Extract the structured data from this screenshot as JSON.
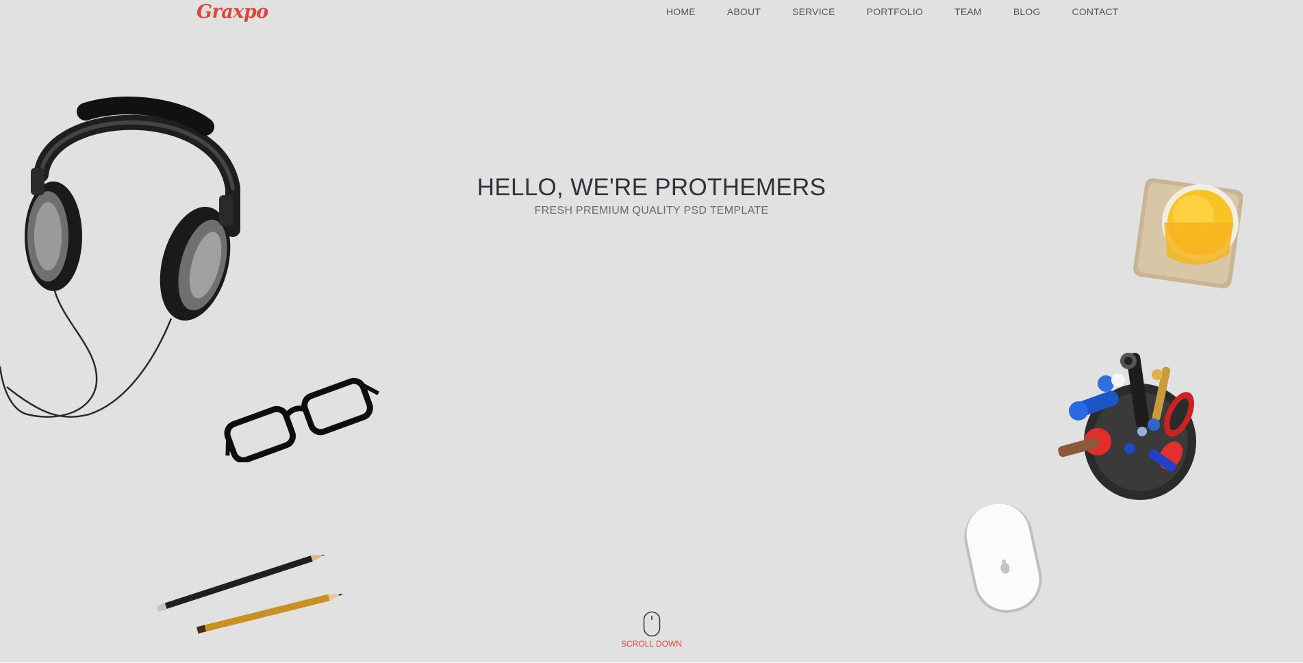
{
  "brand": {
    "logo_text": "Graxpo",
    "accent_color": "#e0453c"
  },
  "nav": {
    "items": [
      {
        "label": "HOME"
      },
      {
        "label": "ABOUT"
      },
      {
        "label": "SERVICE"
      },
      {
        "label": "PORTFOLIO"
      },
      {
        "label": "TEAM"
      },
      {
        "label": "BLOG"
      },
      {
        "label": "CONTACT"
      }
    ]
  },
  "hero": {
    "title": "HELLO, WE'RE PROTHEMERS",
    "subtitle": "FRESH PREMIUM QUALITY PSD TEMPLATE",
    "background_color": "#e1e1e1"
  },
  "scroll": {
    "label": "SCROLL DOWN",
    "icon": "mouse-icon"
  },
  "decorations": [
    {
      "name": "headphones-image"
    },
    {
      "name": "eyeglasses-image"
    },
    {
      "name": "pencils-image"
    },
    {
      "name": "orange-juice-image"
    },
    {
      "name": "pen-holder-image"
    },
    {
      "name": "computer-mouse-image"
    }
  ]
}
